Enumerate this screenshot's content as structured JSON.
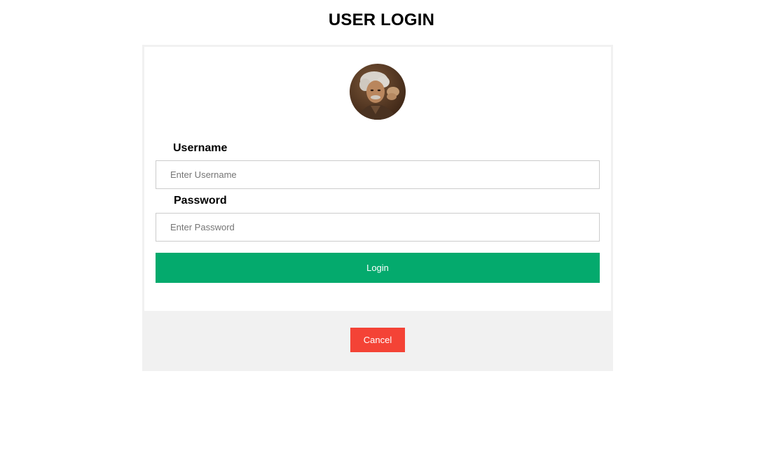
{
  "page": {
    "title": "USER LOGIN"
  },
  "form": {
    "avatar": {
      "icon": "avatar-portrait",
      "description_colors": [
        "#5a3a26",
        "#d9d2c8"
      ]
    },
    "username": {
      "label": "Username",
      "placeholder": "Enter Username",
      "value": ""
    },
    "password": {
      "label": "Password",
      "placeholder": "Enter Password",
      "value": ""
    },
    "login_label": "Login",
    "cancel_label": "Cancel"
  },
  "colors": {
    "login_button": "#04aa6d",
    "cancel_button": "#f44336",
    "container_border": "#f1f1f1",
    "footer_background": "#f1f1f1"
  }
}
